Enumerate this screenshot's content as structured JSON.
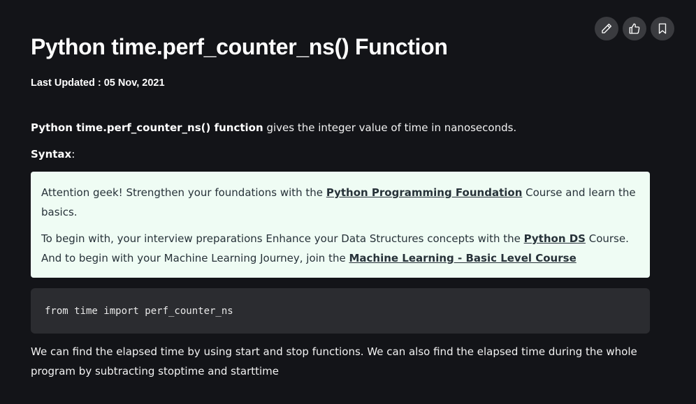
{
  "toolbar": {
    "edit_icon": "pencil-icon",
    "like_icon": "thumbs-up-icon",
    "bookmark_icon": "bookmark-icon"
  },
  "article": {
    "title": "Python time.perf_counter_ns() Function",
    "last_updated_label": "Last Updated : ",
    "last_updated_date": "05 Nov, 2021",
    "intro_bold": "Python time.perf_counter_ns() function",
    "intro_rest": " gives the integer value of time in nanoseconds.",
    "syntax_label": "Syntax",
    "syntax_colon": ":"
  },
  "callout": {
    "p1_prefix": " Attention geek! Strengthen your foundations with the ",
    "p1_link": "Python Programming Foundation",
    "p1_suffix": " Course and learn the basics.",
    "p2_prefix": "To begin with, your interview preparations Enhance your Data Structures concepts with the ",
    "p2_link1": "Python DS",
    "p2_mid": " Course. And to begin with your Machine Learning Journey, join the ",
    "p2_link2": "Machine Learning - Basic Level Course",
    "p2_suffix": ""
  },
  "code": {
    "line1": "from time import perf_counter_ns"
  },
  "body": {
    "paragraph": "We can find the elapsed time by using start and stop functions. We can also find the elapsed time during the whole program by subtracting stoptime and starttime"
  },
  "colors": {
    "background": "#131418",
    "callout_bg": "#effcf4",
    "code_bg": "#2b2c30",
    "button_bg": "#3a3b3f"
  }
}
